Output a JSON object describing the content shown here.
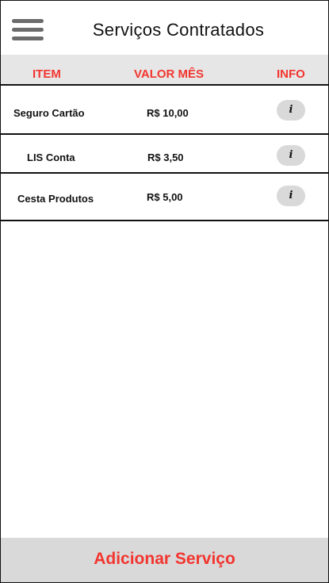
{
  "header": {
    "title": "Serviços Contratados",
    "menu_icon": "hamburger-menu-icon"
  },
  "columns": {
    "item": "ITEM",
    "valor": "VALOR MÊS",
    "info": "INFO"
  },
  "services": [
    {
      "name": "Seguro Cartão",
      "value": "R$ 10,00",
      "info": "i"
    },
    {
      "name": "LIS Conta",
      "value": "R$ 3,50",
      "info": "i"
    },
    {
      "name": "Cesta Produtos",
      "value": "R$ 5,00",
      "info": "i"
    }
  ],
  "footer": {
    "add_label": "Adicionar Serviço"
  },
  "colors": {
    "accent": "#f2352f",
    "header_bg": "#e6e6e6",
    "footer_bg": "#d9d9d9"
  }
}
